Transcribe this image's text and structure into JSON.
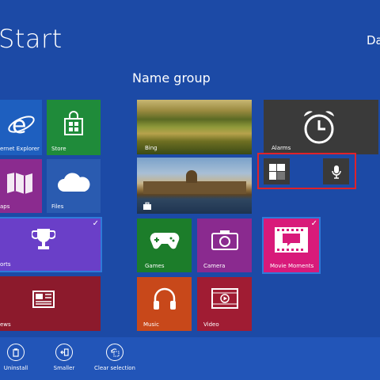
{
  "screen": {
    "title": "Start",
    "user": "Da"
  },
  "group": {
    "name": "Name group"
  },
  "tiles": {
    "internet_explorer": "ernet Explorer",
    "store": "Store",
    "maps": "aps",
    "files": "Files",
    "sports": "orts",
    "news": "ews",
    "bing": "Bing",
    "travel": "",
    "alarms": "Alarms",
    "games": "Games",
    "camera": "Camera",
    "movie_moments": "Movie Moments",
    "music": "Music",
    "video": "Video"
  },
  "selected_check": "✓",
  "appbar": {
    "uninstall": "Uninstall",
    "smaller": "Smaller",
    "clear_selection": "Clear selection"
  },
  "colors": {
    "background": "#1c4aa6",
    "appbar": "#2255b8",
    "highlight_box": "#e0222a",
    "store": "#1f8b3a",
    "maps": "#8b2b8f",
    "files": "#2a5bb0",
    "sports": "#6a3fc8",
    "news": "#8c1a2c",
    "alarms": "#3a3a3a",
    "games": "#1c7d2a",
    "camera": "#8a2a8f",
    "movie_moments": "#d81a7a",
    "music": "#c8481a",
    "video": "#a01c33"
  }
}
